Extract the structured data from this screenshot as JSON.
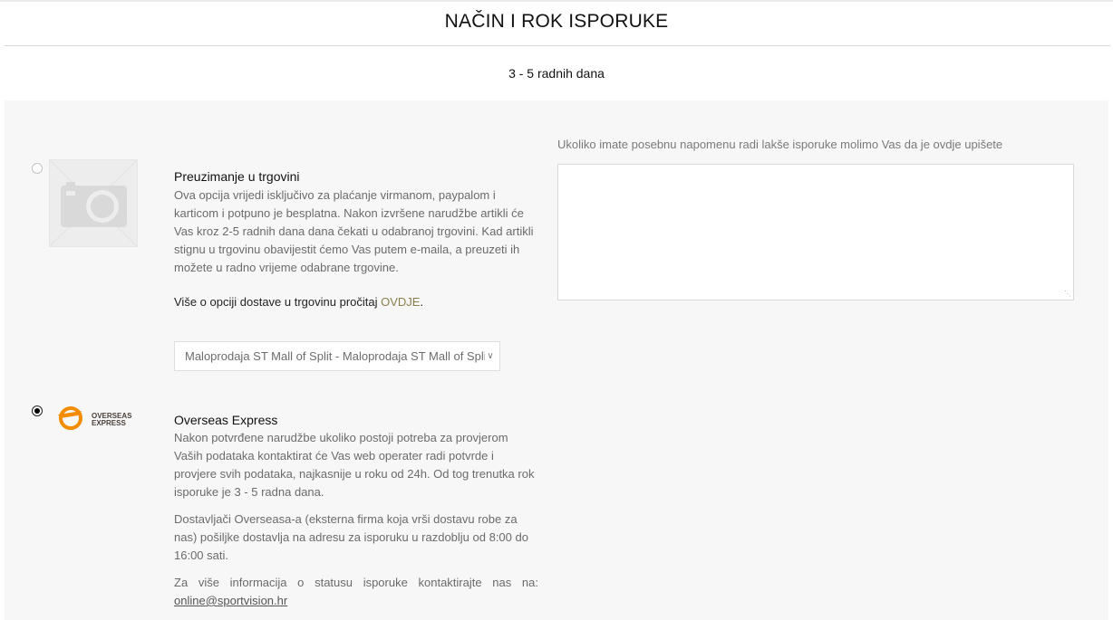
{
  "header": {
    "title": "NAČIN I ROK ISPORUKE",
    "subtitle": "3 - 5 radnih dana"
  },
  "options": [
    {
      "title": "Preuzimanje u trgovini",
      "selected": false,
      "image": "camera-placeholder-icon",
      "description": "Ova opcija vrijedi isključivo za plaćanje virmanom, paypalom i karticom i potpuno je besplatna. Nakon izvršene narudžbe artikli će Vas kroz 2-5 radnih dana dana čekati u odabranoj trgovini. Kad artikli stignu u trgovinu obavijestit ćemo Vas putem e-maila, a preuzeti ih možete u radno vrijeme odabrane trgovine.",
      "more_text": "Više o opciji dostave u trgovinu pročitaj ",
      "more_link": "OVDJE",
      "more_end": ".",
      "store_select": "Maloprodaja ST Mall of Split - Maloprodaja ST Mall of Split"
    },
    {
      "title": "Overseas Express",
      "selected": true,
      "logo_line1": "OVERSEAS",
      "logo_line2": "EXPRESS",
      "paragraph1": "Nakon potvrđene narudžbe ukoliko postoji potreba za provjerom Vaših podataka kontaktirat će Vas web operater radi potvrde i provjere svih podataka, najkasnije u roku od 24h. Od tog trenutka rok isporuke je 3 - 5 radna dana.",
      "paragraph2": "Dostavljači Overseasa-a (eksterna firma koja vrši dostavu robe za nas) pošiljke dostavlja na adresu za isporuku u razdoblju od 8:00 do 16:00 sati.",
      "paragraph3": "Za više informacija o statusu isporuke kontaktirajte nas na:",
      "email": "online@sportvision.hr"
    }
  ],
  "note": {
    "label": "Ukoliko imate posebnu napomenu radi lakše isporuke molimo Vas da je ovdje upišete",
    "value": ""
  },
  "colors": {
    "panel_bg": "#f7f7f7",
    "link": "#8a7e4a",
    "logo_orange": "#f28c00",
    "logo_text": "#4a3f3a"
  }
}
